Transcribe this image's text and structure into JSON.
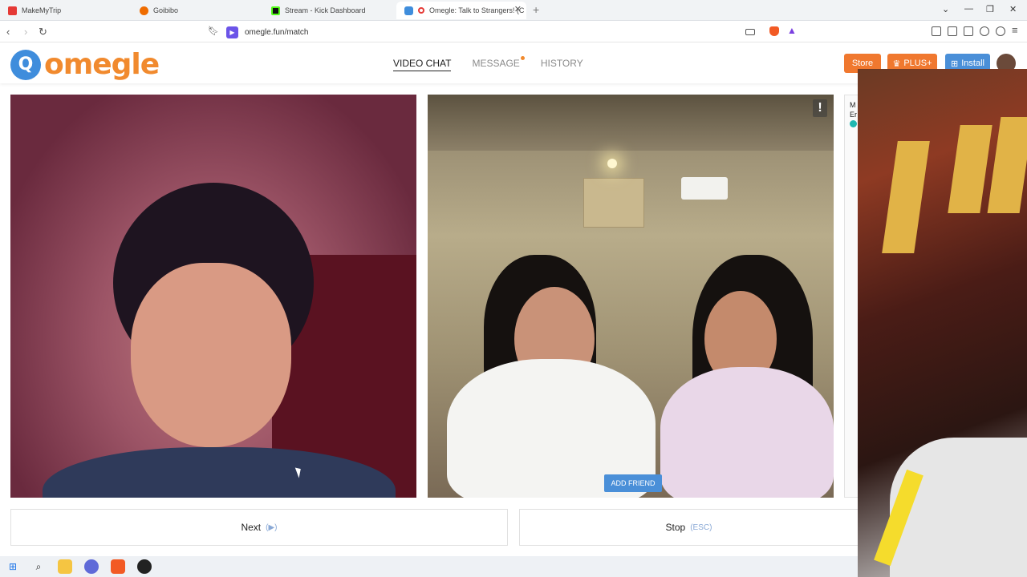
{
  "browser": {
    "tabs": [
      {
        "title": "MakeMyTrip",
        "color": "#e53935"
      },
      {
        "title": "Goibibo",
        "color": "#ef6c00"
      },
      {
        "title": "Stream - Kick Dashboard",
        "color": "#53fc18"
      },
      {
        "title": "Omegle: Talk to Strangers! (C",
        "color": "#3f8ddc"
      }
    ],
    "url": "omegle.fun/match"
  },
  "site": {
    "logo_letter": "Q",
    "logo_word": "omegle",
    "nav": [
      {
        "label": "VIDEO CHAT"
      },
      {
        "label": "MESSAGE"
      },
      {
        "label": "HISTORY"
      }
    ],
    "store_label": "Store",
    "plus_label": "PLUS+",
    "install_label": "Install"
  },
  "video": {
    "report_glyph": "!",
    "add_friend_label": "ADD FRIEND"
  },
  "chat_stub": {
    "line1": "M",
    "line2": "Er"
  },
  "controls": {
    "next_label": "Next",
    "next_hint": "(▶)",
    "stop_label": "Stop",
    "stop_hint": "(ESC)"
  },
  "colors": {
    "accent_orange": "#f18a2e",
    "accent_blue": "#3f8ddc",
    "install_blue": "#4a8fd8",
    "store_orange": "#f0782f"
  }
}
